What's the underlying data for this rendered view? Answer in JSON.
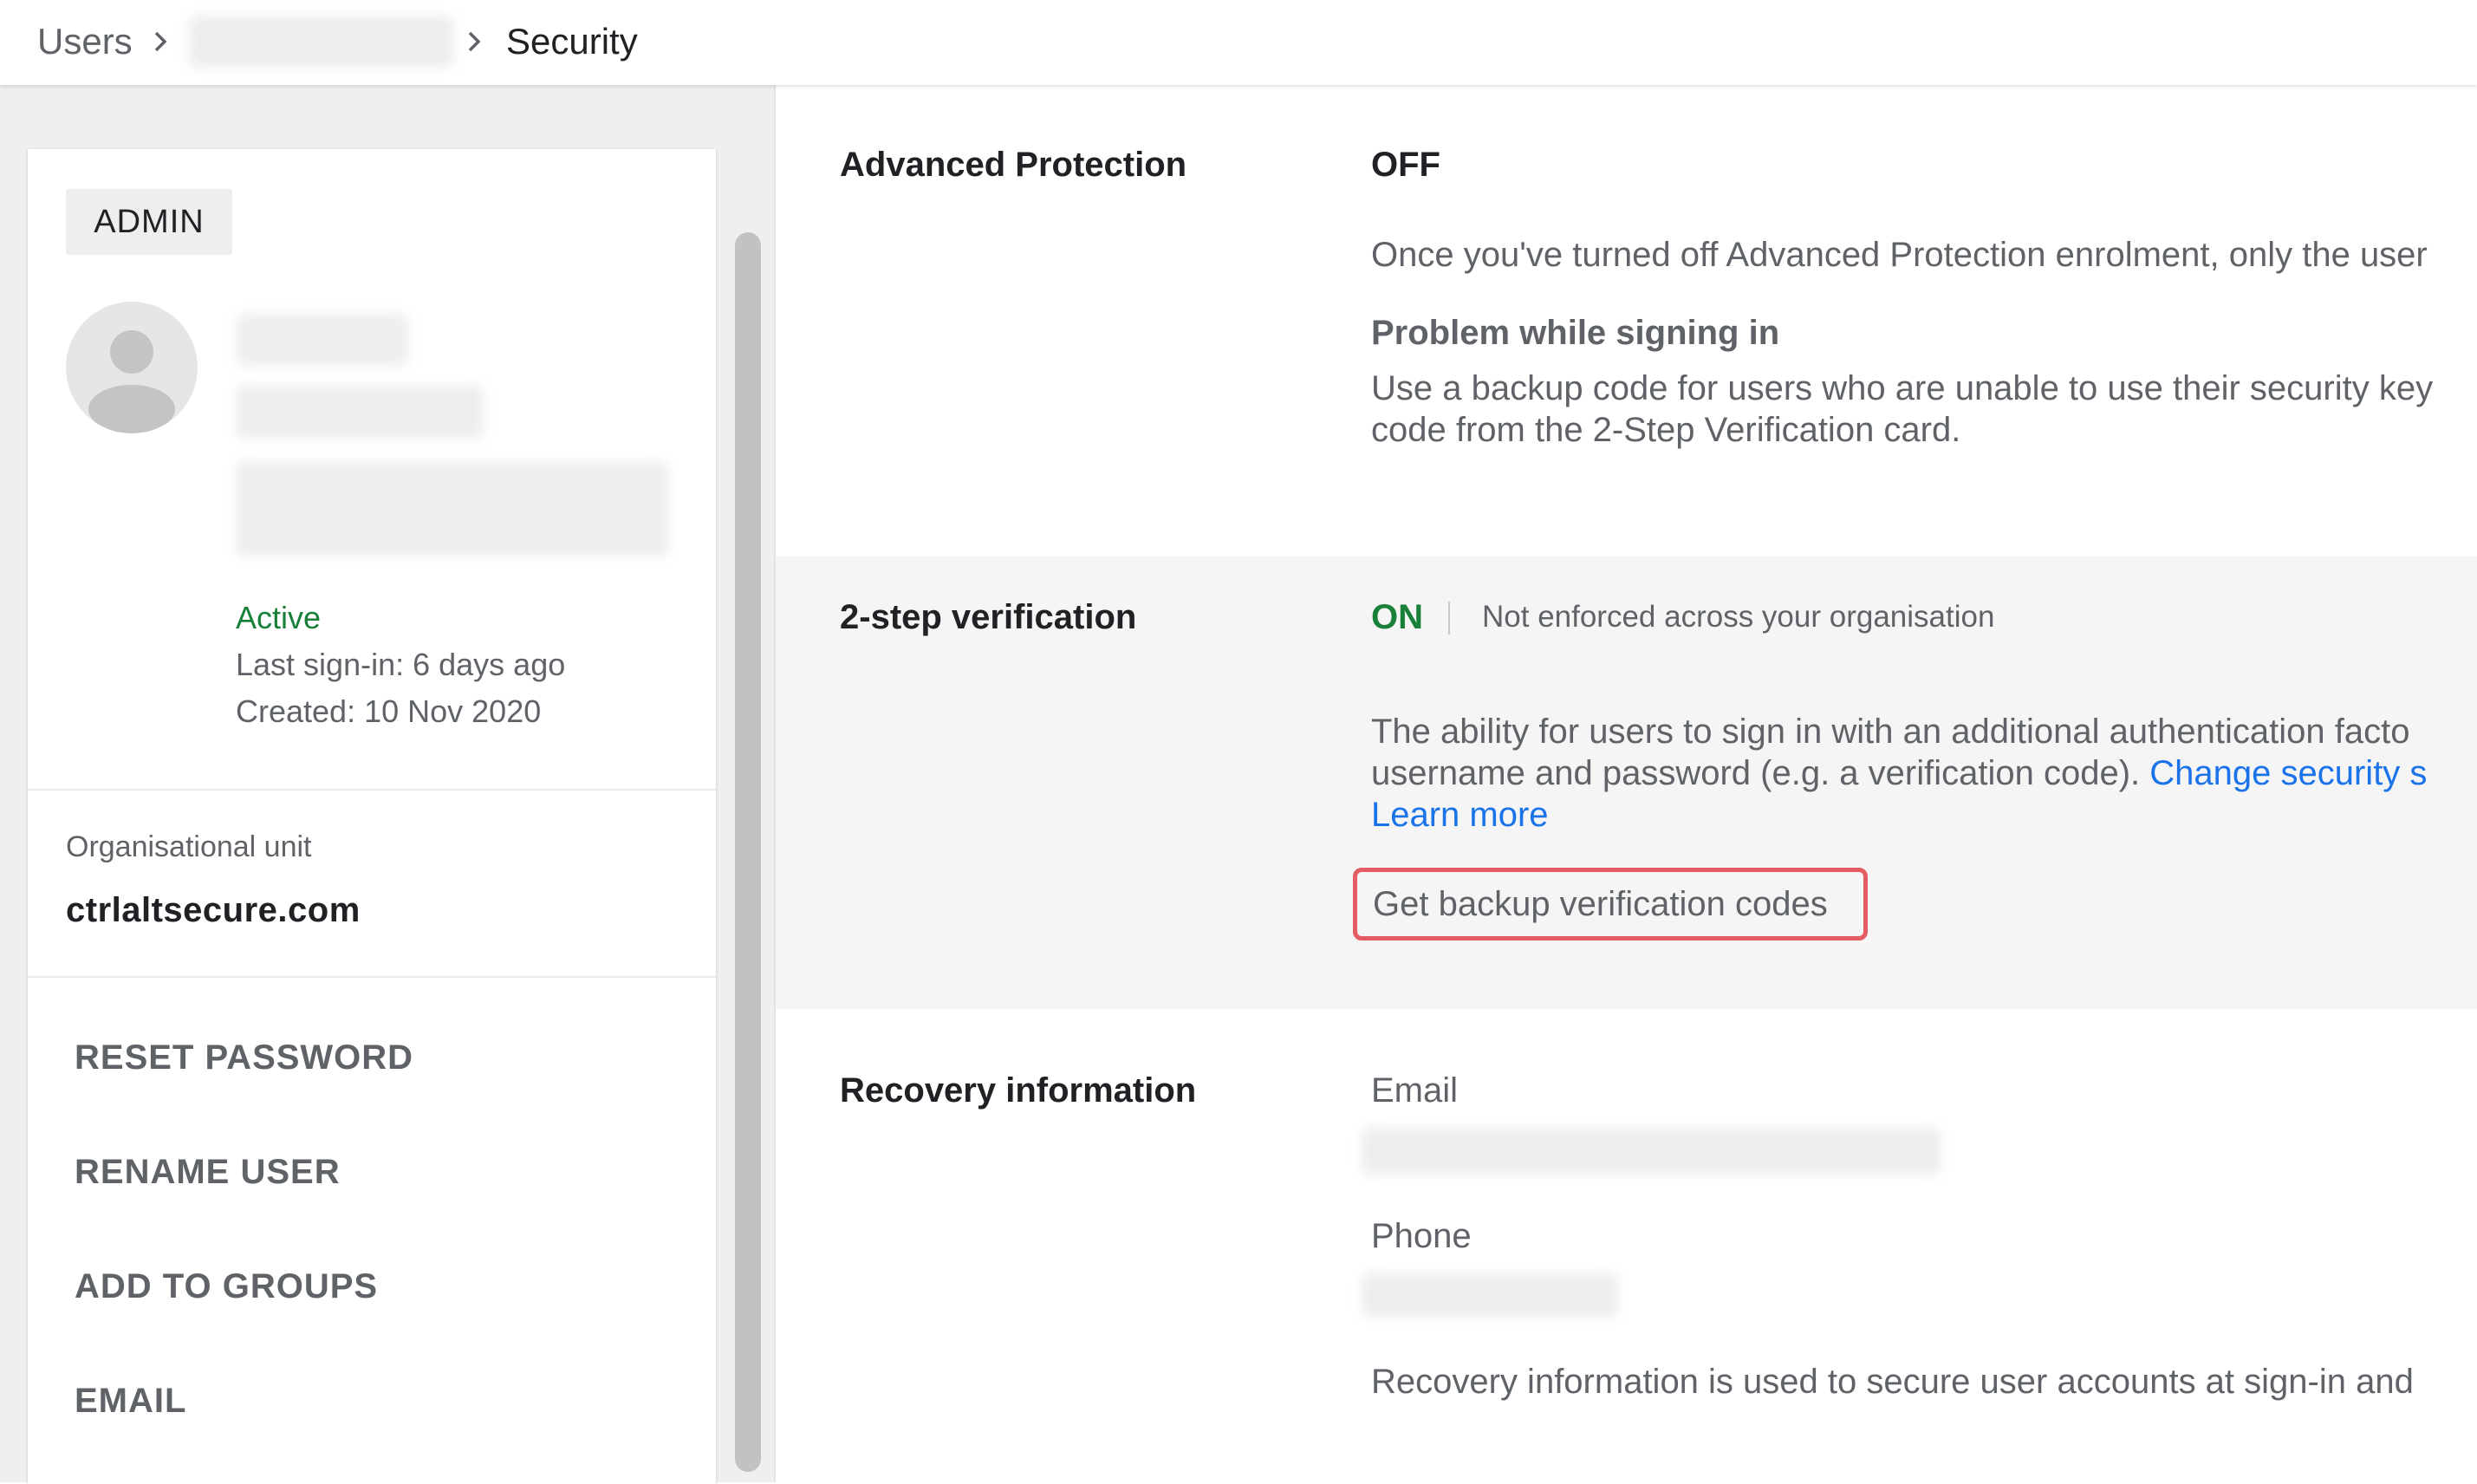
{
  "breadcrumb": {
    "root": "Users",
    "current": "Security"
  },
  "user": {
    "role": "ADMIN",
    "status": "Active",
    "last_signin": "Last sign-in: 6 days ago",
    "created": "Created: 10 Nov 2020",
    "org_unit_label": "Organisational unit",
    "org_unit_value": "ctrlaltsecure.com"
  },
  "actions": [
    "RESET PASSWORD",
    "RENAME USER",
    "ADD TO GROUPS",
    "EMAIL"
  ],
  "advanced_protection": {
    "title": "Advanced Protection",
    "status": "OFF",
    "description": "Once you've turned off Advanced Protection enrolment, only the user",
    "problem_title": "Problem while signing in",
    "problem_line1": "Use a backup code for users who are unable to use their security key",
    "problem_line2": "code from the 2-Step Verification card."
  },
  "two_step": {
    "title": "2-step verification",
    "status": "ON",
    "enforcement": "Not enforced across your organisation",
    "description_line1": "The ability for users to sign in with an additional authentication facto",
    "description_line2": "username and password (e.g. a verification code).",
    "change_link": "Change security s",
    "learn_more": "Learn more",
    "backup_button": "Get backup verification codes"
  },
  "recovery": {
    "title": "Recovery information",
    "email_label": "Email",
    "phone_label": "Phone",
    "note": "Recovery information is used to secure user accounts at sign-in and"
  },
  "colors": {
    "active_green": "#188038",
    "link_blue": "#1a73e8",
    "highlight_red": "#e35d62"
  }
}
